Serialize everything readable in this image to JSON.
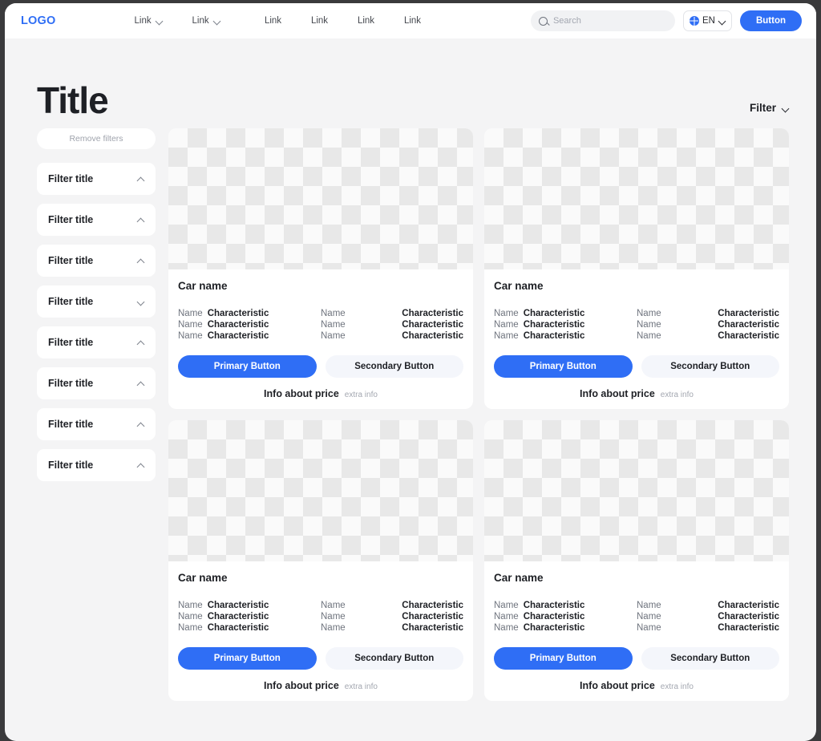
{
  "header": {
    "logo": "LOGO",
    "nav": [
      {
        "label": "Link",
        "has_chevron": true
      },
      {
        "label": "Link",
        "has_chevron": true
      },
      {
        "label": "Link",
        "has_chevron": false
      },
      {
        "label": "Link",
        "has_chevron": false
      },
      {
        "label": "Link",
        "has_chevron": false
      },
      {
        "label": "Link",
        "has_chevron": false
      }
    ],
    "search_placeholder": "Search",
    "language": "EN",
    "button_label": "Button",
    "accent_color": "#2f6ef5"
  },
  "page": {
    "title": "Title",
    "filter_toggle_label": "Filter"
  },
  "sidebar": {
    "remove_filters_label": "Remove filters",
    "filters": [
      {
        "label": "Filter title",
        "expanded": true
      },
      {
        "label": "Filter title",
        "expanded": true
      },
      {
        "label": "Filter title",
        "expanded": true
      },
      {
        "label": "Filter title",
        "expanded": false
      },
      {
        "label": "Filter title",
        "expanded": true
      },
      {
        "label": "Filter title",
        "expanded": true
      },
      {
        "label": "Filter title",
        "expanded": true
      },
      {
        "label": "Filter title",
        "expanded": true
      }
    ]
  },
  "cards": [
    {
      "name": "Car name",
      "specs": [
        {
          "name1": "Name",
          "value1": "Characteristic",
          "name2": "Name",
          "value2": "Characteristic"
        },
        {
          "name1": "Name",
          "value1": "Characteristic",
          "name2": "Name",
          "value2": "Characteristic"
        },
        {
          "name1": "Name",
          "value1": "Characteristic",
          "name2": "Name",
          "value2": "Characteristic"
        }
      ],
      "primary_label": "Primary Button",
      "secondary_label": "Secondary Button",
      "price_main": "Info about price",
      "price_extra": "extra info"
    },
    {
      "name": "Car name",
      "specs": [
        {
          "name1": "Name",
          "value1": "Characteristic",
          "name2": "Name",
          "value2": "Characteristic"
        },
        {
          "name1": "Name",
          "value1": "Characteristic",
          "name2": "Name",
          "value2": "Characteristic"
        },
        {
          "name1": "Name",
          "value1": "Characteristic",
          "name2": "Name",
          "value2": "Characteristic"
        }
      ],
      "primary_label": "Primary Button",
      "secondary_label": "Secondary Button",
      "price_main": "Info about price",
      "price_extra": "extra info"
    },
    {
      "name": "Car name",
      "specs": [
        {
          "name1": "Name",
          "value1": "Characteristic",
          "name2": "Name",
          "value2": "Characteristic"
        },
        {
          "name1": "Name",
          "value1": "Characteristic",
          "name2": "Name",
          "value2": "Characteristic"
        },
        {
          "name1": "Name",
          "value1": "Characteristic",
          "name2": "Name",
          "value2": "Characteristic"
        }
      ],
      "primary_label": "Primary Button",
      "secondary_label": "Secondary Button",
      "price_main": "Info about price",
      "price_extra": "extra info"
    },
    {
      "name": "Car name",
      "specs": [
        {
          "name1": "Name",
          "value1": "Characteristic",
          "name2": "Name",
          "value2": "Characteristic"
        },
        {
          "name1": "Name",
          "value1": "Characteristic",
          "name2": "Name",
          "value2": "Characteristic"
        },
        {
          "name1": "Name",
          "value1": "Characteristic",
          "name2": "Name",
          "value2": "Characteristic"
        }
      ],
      "primary_label": "Primary Button",
      "secondary_label": "Secondary Button",
      "price_main": "Info about price",
      "price_extra": "extra info"
    }
  ]
}
